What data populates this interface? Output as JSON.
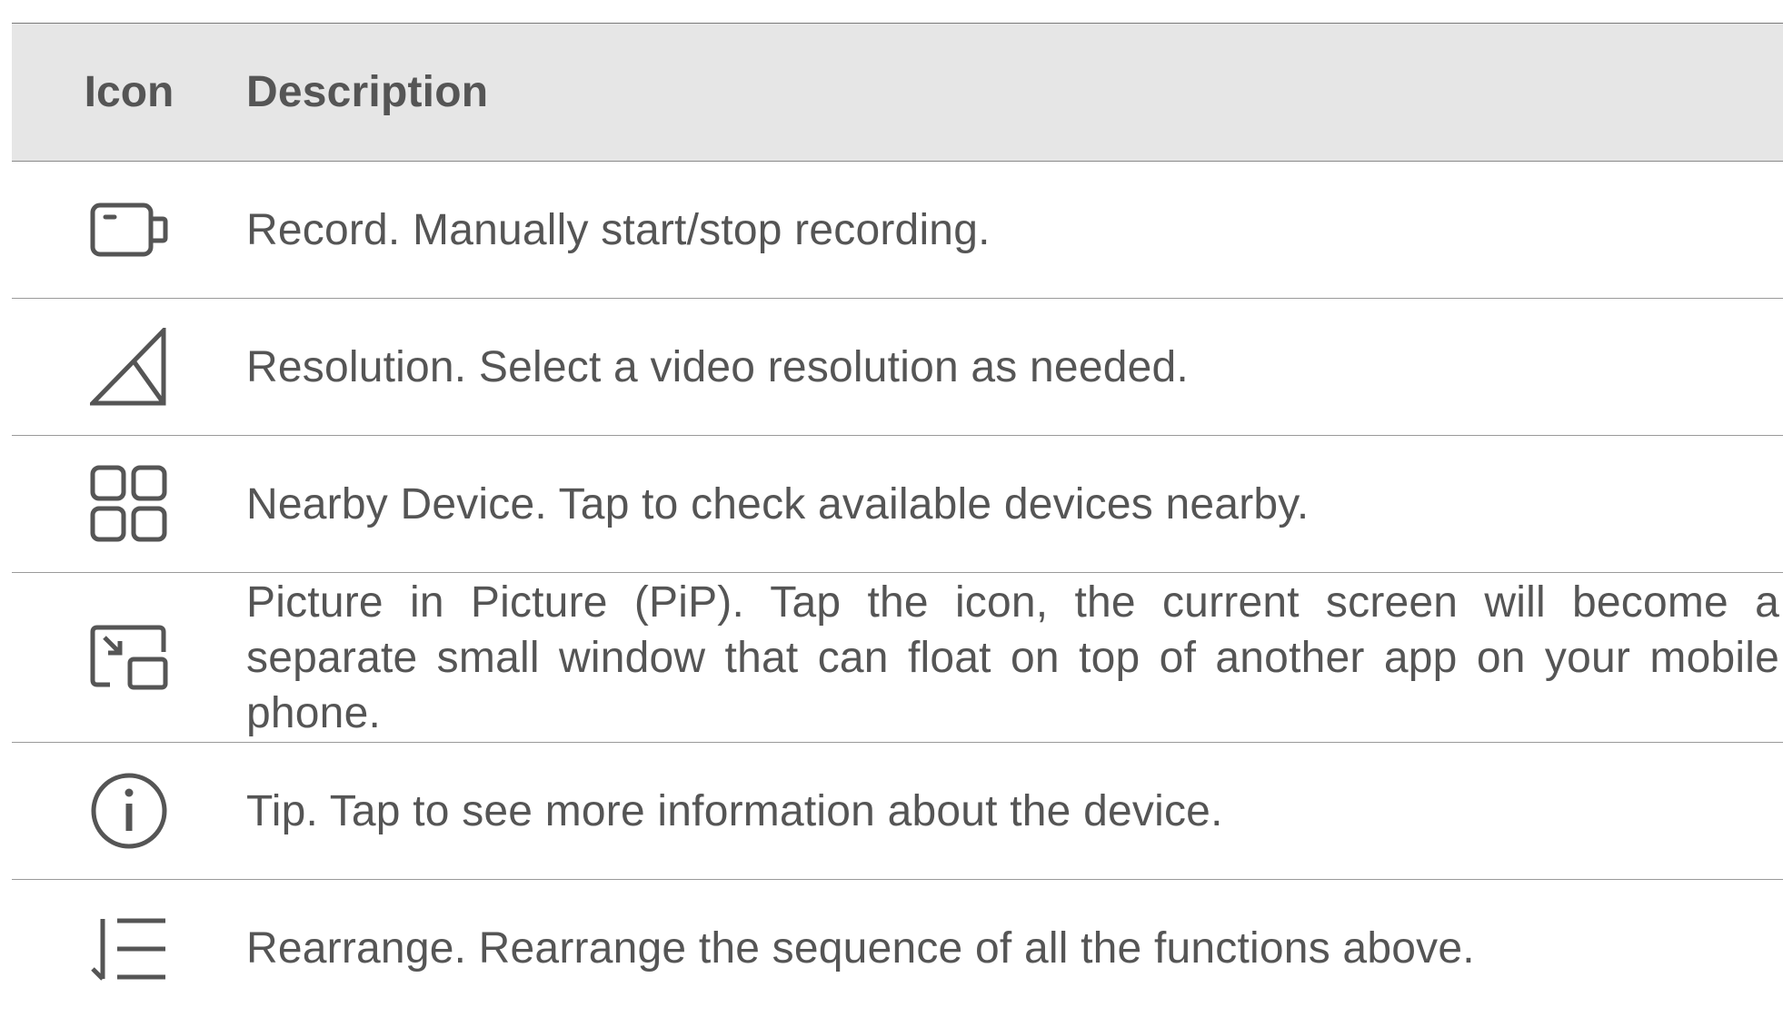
{
  "table": {
    "headers": {
      "icon": "Icon",
      "description": "Description"
    },
    "rows": [
      {
        "icon": "video-camera-icon",
        "description": "Record. Manually start/stop recording."
      },
      {
        "icon": "resolution-triangle-icon",
        "description": "Resolution. Select a video resolution as needed."
      },
      {
        "icon": "grid-icon",
        "description": "Nearby Device. Tap to check available devices nearby."
      },
      {
        "icon": "picture-in-picture-icon",
        "description": "Picture in Picture (PiP). Tap the icon, the current screen will become a separate small window that can float on top of another app on your mobile phone."
      },
      {
        "icon": "info-icon",
        "description": "Tip. Tap to see more information about the device."
      },
      {
        "icon": "rearrange-list-icon",
        "description": "Rearrange. Rearrange the sequence of all the functions above."
      }
    ]
  },
  "colors": {
    "header_bg": "#e6e6e6",
    "text": "#555555",
    "rule": "#9a9a9a"
  }
}
